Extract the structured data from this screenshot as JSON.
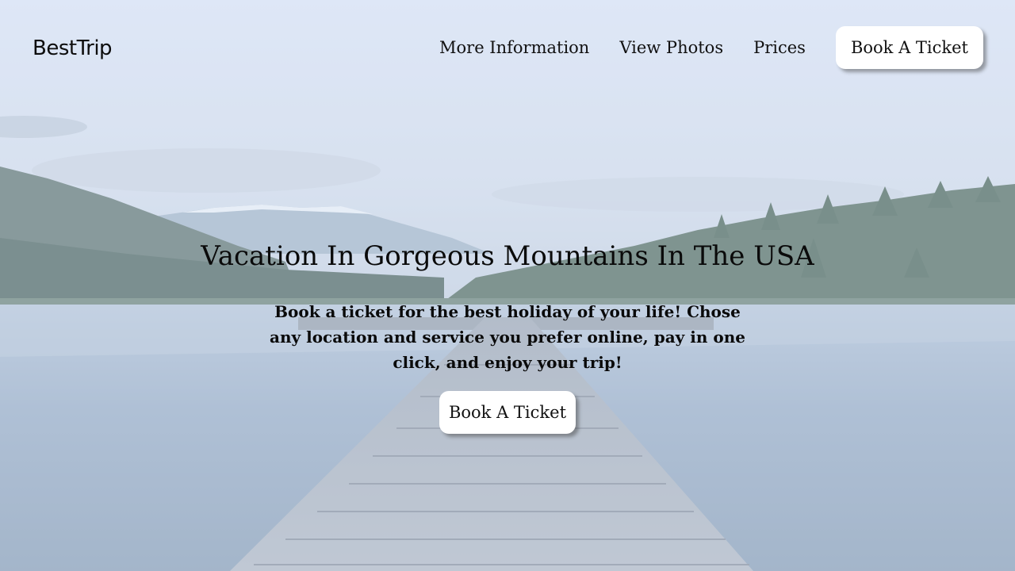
{
  "header": {
    "logo": "BestTrip",
    "nav": [
      {
        "label": "More Information"
      },
      {
        "label": "View Photos"
      },
      {
        "label": "Prices"
      }
    ],
    "cta_label": "Book A Ticket"
  },
  "hero": {
    "background": "mountain-lake-pier-photo",
    "title": "Vacation In Gorgeous Mountains In The USA",
    "text": "Book a ticket for the best holiday of your life! Chose any location and service you prefer online, pay in one click, and enjoy your trip!",
    "cta_label": "Book A Ticket"
  },
  "colors": {
    "button_bg": "#ffffff",
    "text": "#0a0a0a"
  }
}
